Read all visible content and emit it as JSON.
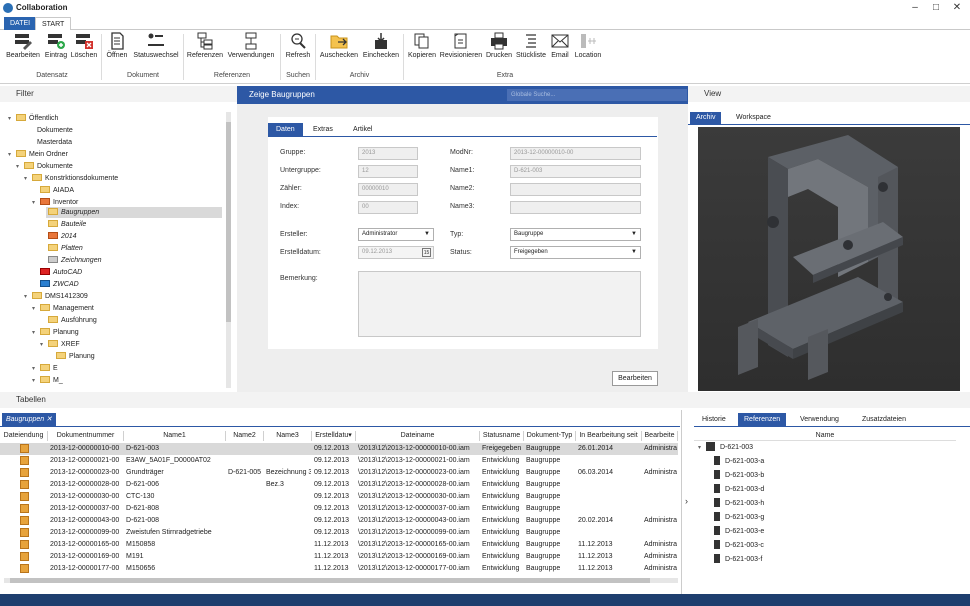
{
  "window": {
    "title": "Collaboration"
  },
  "menu": {
    "datei": "DATEI",
    "start": "START"
  },
  "ribbon": {
    "buttons": [
      "Bearbeiten",
      "Eintrag",
      "Löschen",
      "Öffnen",
      "Statuswechsel",
      "Referenzen",
      "Verwendungen",
      "Refresh",
      "Auschecken",
      "Einchecken",
      "Kopieren",
      "Revisionieren",
      "Drucken",
      "Stückliste",
      "Email",
      "Location"
    ],
    "groups": [
      "Datensatz",
      "Dokument",
      "Referenzen",
      "Suchen",
      "Archiv",
      "Extra"
    ]
  },
  "filter": {
    "title": "Filter",
    "tree": [
      "Öffentlich",
      "Dokumente",
      "Masterdata",
      "Mein Ordner",
      "Dokumente",
      "Konstrktionsdokumente",
      "AIADA",
      "Inventor",
      "Baugruppen",
      "Bauteile",
      "2014",
      "Platten",
      "Zeichnungen",
      "AutoCAD",
      "ZWCAD",
      "DMS1412309",
      "Management",
      "Ausführung",
      "Planung",
      "XREF",
      "Planung",
      "E",
      "M_"
    ]
  },
  "center": {
    "header": "Zeige Baugruppen",
    "search_placeholder": "Globale Suche...",
    "tabs": [
      "Daten",
      "Extras",
      "Artikel"
    ],
    "fields": {
      "gruppe_label": "Gruppe:",
      "gruppe": "2013",
      "untergruppe_label": "Untergruppe:",
      "untergruppe": "12",
      "zaehler_label": "Zähler:",
      "zaehler": "00000010",
      "index_label": "Index:",
      "index": "00",
      "modnr_label": "ModNr:",
      "modnr": "2013-12-00000010-00",
      "name1_label": "Name1:",
      "name1": "D-621-003",
      "name2_label": "Name2:",
      "name3_label": "Name3:",
      "ersteller_label": "Ersteller:",
      "ersteller": "Administrator",
      "erstelldatum_label": "Erstelldatum:",
      "erstelldatum": "09.12.2013",
      "typ_label": "Typ:",
      "typ": "Baugruppe",
      "status_label": "Status:",
      "status": "Freigegeben",
      "bemerkung_label": "Bemerkung:"
    },
    "edit_button": "Bearbeiten"
  },
  "view": {
    "title": "View",
    "tabs": [
      "Archiv",
      "Workspace"
    ]
  },
  "tables": {
    "title": "Tabellen",
    "tab": "Baugruppen",
    "columns": [
      "Dateiendung",
      "Dokumentnummer",
      "Name1",
      "Name2",
      "Name3",
      "Erstelldatu▾",
      "Dateiname",
      "Statusname",
      "Dokument-Typ",
      "In Bearbeitung seit",
      "Bearbeite"
    ],
    "rows": [
      [
        "2013-12-00000010-00",
        "D-621-003",
        "",
        "",
        "09.12.2013",
        "\\2013\\12\\2013-12-00000010-00.iam",
        "Freigegeben",
        "Baugruppe",
        "26.01.2014",
        "Administrat"
      ],
      [
        "2013-12-00000021-00",
        "E3AW_5A01F_D0000AT02",
        "",
        "",
        "09.12.2013",
        "\\2013\\12\\2013-12-00000021-00.iam",
        "Entwicklung",
        "Baugruppe",
        "",
        ""
      ],
      [
        "2013-12-00000023-00",
        "Grundträger",
        "D-621-005",
        "Bezeichnung 3",
        "09.12.2013",
        "\\2013\\12\\2013-12-00000023-00.iam",
        "Entwicklung",
        "Baugruppe",
        "06.03.2014",
        "Administrat"
      ],
      [
        "2013-12-00000028-00",
        "D-621-006",
        "",
        "Bez.3",
        "09.12.2013",
        "\\2013\\12\\2013-12-00000028-00.iam",
        "Entwicklung",
        "Baugruppe",
        "",
        ""
      ],
      [
        "2013-12-00000030-00",
        "CTC-130",
        "",
        "",
        "09.12.2013",
        "\\2013\\12\\2013-12-00000030-00.iam",
        "Entwicklung",
        "Baugruppe",
        "",
        ""
      ],
      [
        "2013-12-00000037-00",
        "D-621-808",
        "",
        "",
        "09.12.2013",
        "\\2013\\12\\2013-12-00000037-00.iam",
        "Entwicklung",
        "Baugruppe",
        "",
        ""
      ],
      [
        "2013-12-00000043-00",
        "D-621-008",
        "",
        "",
        "09.12.2013",
        "\\2013\\12\\2013-12-00000043-00.iam",
        "Entwicklung",
        "Baugruppe",
        "20.02.2014",
        "Administrat"
      ],
      [
        "2013-12-00000099-00",
        "Zweistufen Stirnradgetriebe",
        "",
        "",
        "09.12.2013",
        "\\2013\\12\\2013-12-00000099-00.iam",
        "Entwicklung",
        "Baugruppe",
        "",
        ""
      ],
      [
        "2013-12-00000165-00",
        "M150858",
        "",
        "",
        "11.12.2013",
        "\\2013\\12\\2013-12-00000165-00.iam",
        "Entwicklung",
        "Baugruppe",
        "11.12.2013",
        "Administrat"
      ],
      [
        "2013-12-00000169-00",
        "M191",
        "",
        "",
        "11.12.2013",
        "\\2013\\12\\2013-12-00000169-00.iam",
        "Entwicklung",
        "Baugruppe",
        "11.12.2013",
        "Administrat"
      ],
      [
        "2013-12-00000177-00",
        "M150656",
        "",
        "",
        "11.12.2013",
        "\\2013\\12\\2013-12-00000177-00.iam",
        "Entwicklung",
        "Baugruppe",
        "11.12.2013",
        "Administrat"
      ]
    ]
  },
  "references": {
    "tabs": [
      "Historie",
      "Referenzen",
      "Verwendung",
      "Zusatzdateien"
    ],
    "column": "Name",
    "root": "D-621-003",
    "children": [
      "D-621-003-a",
      "D-621-003-b",
      "D-621-003-d",
      "D-621-003-h",
      "D-621-003-g",
      "D-621-003-e",
      "D-621-003-c",
      "D-621-003-f"
    ]
  },
  "colors": {
    "accent": "#2d58a5",
    "selection": "#d9d9d9"
  }
}
